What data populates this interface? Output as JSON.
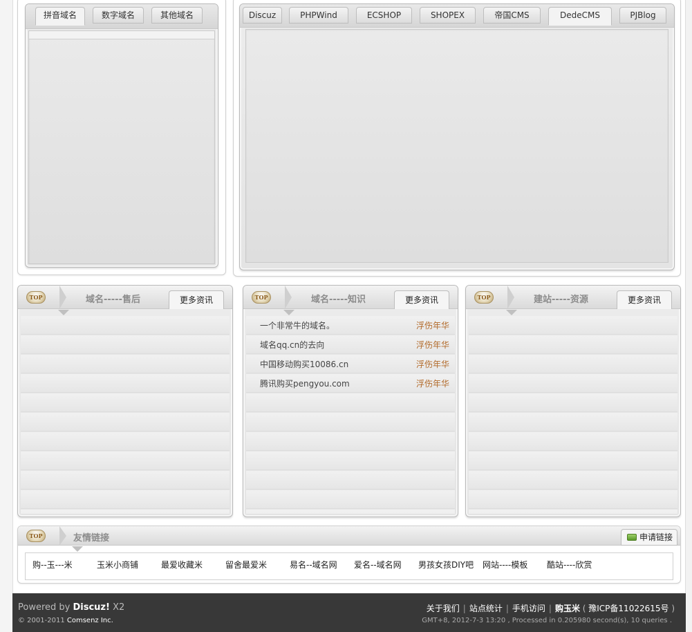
{
  "domain_tabs": {
    "tabs": [
      {
        "label": "拼音域名",
        "active": true
      },
      {
        "label": "数字域名",
        "active": false
      },
      {
        "label": "其他域名",
        "active": false
      }
    ]
  },
  "cms_tabs": {
    "tabs": [
      {
        "label": "Discuz",
        "active": false
      },
      {
        "label": "PHPWind",
        "active": false
      },
      {
        "label": "ECSHOP",
        "active": false
      },
      {
        "label": "SHOPEX",
        "active": false
      },
      {
        "label": "帝国CMS",
        "active": false
      },
      {
        "label": "DedeCMS",
        "active": true
      },
      {
        "label": "PJBlog",
        "active": false
      }
    ]
  },
  "badge_text": "TOP",
  "news_panels": [
    {
      "title": "域名-----售后",
      "more_label": "更多资讯",
      "items": []
    },
    {
      "title": "域名-----知识",
      "more_label": "更多资讯",
      "items": [
        {
          "title": "一个非常牛的域名。",
          "author": "浮伤年华"
        },
        {
          "title": "域名qq.cn的去向",
          "author": "浮伤年华"
        },
        {
          "title": "中国移动购买10086.cn",
          "author": "浮伤年华"
        },
        {
          "title": "腾讯购买pengyou.com",
          "author": "浮伤年华"
        }
      ]
    },
    {
      "title": "建站-----资源",
      "more_label": "更多资讯",
      "items": []
    }
  ],
  "friend_links": {
    "title": "友情链接",
    "apply_label": "申请链接",
    "links": [
      "购--玉---米",
      "玉米小商铺",
      "最爱收藏米",
      "留舍最爱米",
      "易名--域名网",
      "爱名--域名网",
      "男孩女孩DIY吧",
      "网站----模板",
      "酷站----欣赏"
    ]
  },
  "footer": {
    "powered_prefix": "Powered by ",
    "powered_brand": "Discuz!",
    "powered_version": " X2",
    "copyright_prefix": "© 2001-2011 ",
    "copyright_company": "Comsenz Inc.",
    "nav_links": [
      "关于我们",
      "站点统计",
      "手机访问",
      "购玉米"
    ],
    "icp": "豫ICP备11022615号",
    "stats": "GMT+8, 2012-7-3 13:20 , Processed in 0.205980 second(s), 10 queries ."
  }
}
